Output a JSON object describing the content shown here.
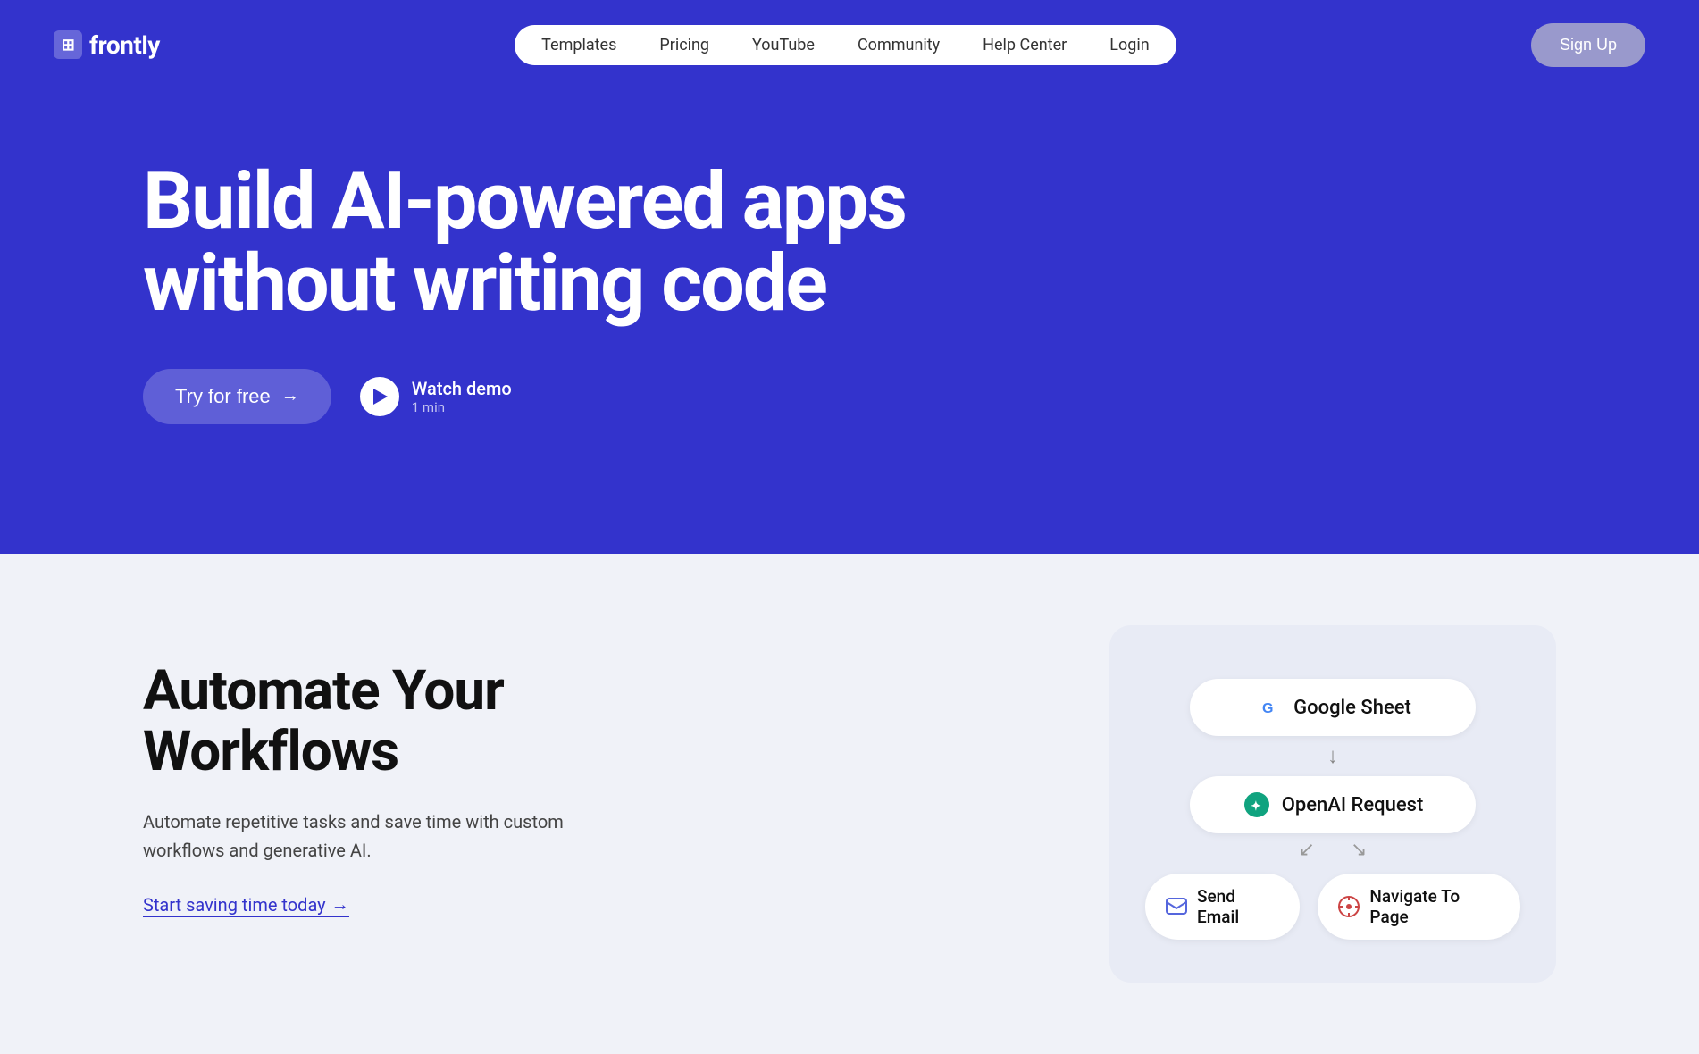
{
  "brand": {
    "name": "frontly",
    "logo_symbol": "⊞"
  },
  "header": {
    "nav_items": [
      {
        "label": "Templates",
        "id": "nav-templates"
      },
      {
        "label": "Pricing",
        "id": "nav-pricing"
      },
      {
        "label": "YouTube",
        "id": "nav-youtube"
      },
      {
        "label": "Community",
        "id": "nav-community"
      },
      {
        "label": "Help Center",
        "id": "nav-helpcenter"
      },
      {
        "label": "Login",
        "id": "nav-login"
      }
    ],
    "signup_label": "Sign Up"
  },
  "hero": {
    "title_line1": "Build AI-powered apps",
    "title_line2": "without writing code",
    "try_free_label": "Try for free",
    "watch_demo_label": "Watch demo",
    "watch_demo_sub": "1 min"
  },
  "lower": {
    "title_line1": "Automate Your",
    "title_line2": "Workflows",
    "description": "Automate repetitive tasks and save time with custom workflows and generative AI.",
    "cta_label": "Start saving time today",
    "cta_arrow": "→"
  },
  "workflow_card": {
    "step1_label": "Google Sheet",
    "step2_label": "OpenAI Request",
    "step3a_label": "Send Email",
    "step3b_label": "Navigate To Page"
  },
  "colors": {
    "primary_blue": "#3333cc",
    "bg_light": "#f0f2f8",
    "card_bg": "#e8ebf5",
    "green_ai": "#10a37f"
  }
}
